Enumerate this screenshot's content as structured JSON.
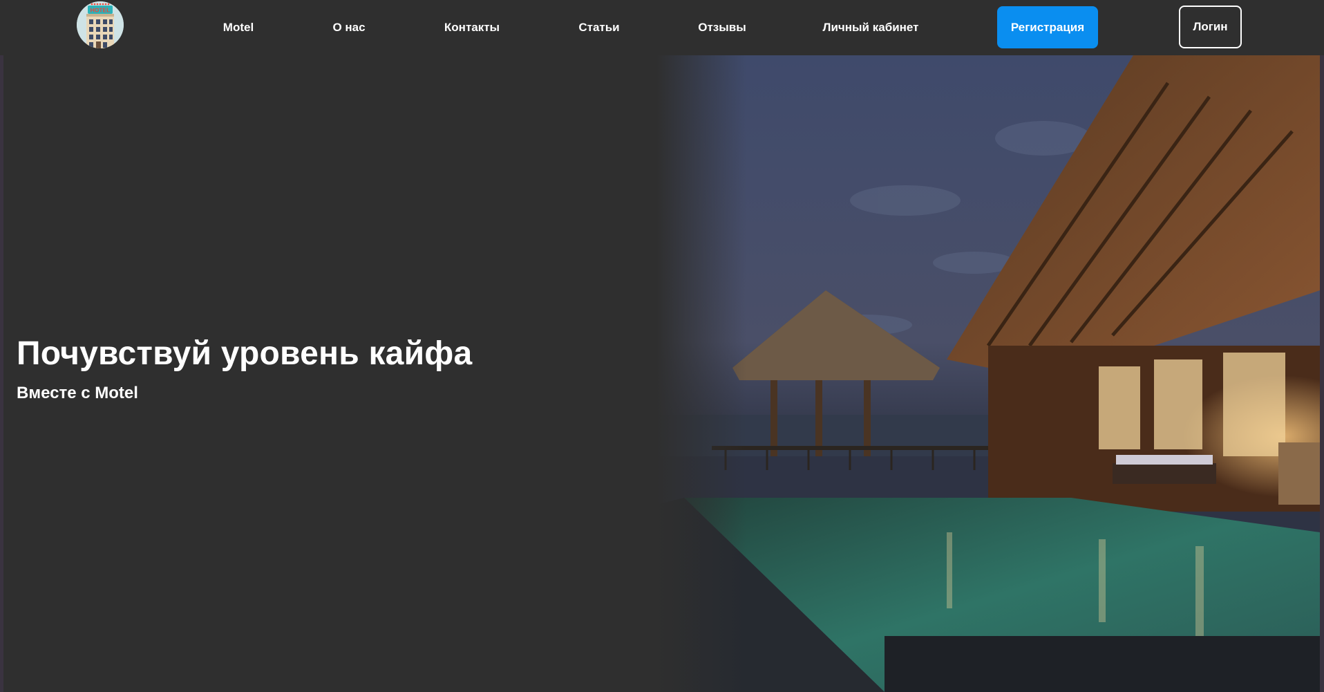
{
  "header": {
    "logo": {
      "icon": "hotel-building-icon",
      "sign_text": "HOTEL"
    },
    "nav": [
      {
        "label": "Motel"
      },
      {
        "label": "О нас"
      },
      {
        "label": "Контакты"
      },
      {
        "label": "Статьи"
      },
      {
        "label": "Отзывы"
      },
      {
        "label": "Личный кабинет"
      }
    ],
    "register_label": "Регистрация",
    "login_label": "Логин"
  },
  "hero": {
    "title": "Почувствуй уровень кайфа",
    "subtitle": "Вместе с Motel",
    "image": "tropical-villa-pool-at-dusk"
  },
  "colors": {
    "background": "#2f2f2f",
    "accent": "#0a8ef0",
    "text": "#ffffff"
  }
}
